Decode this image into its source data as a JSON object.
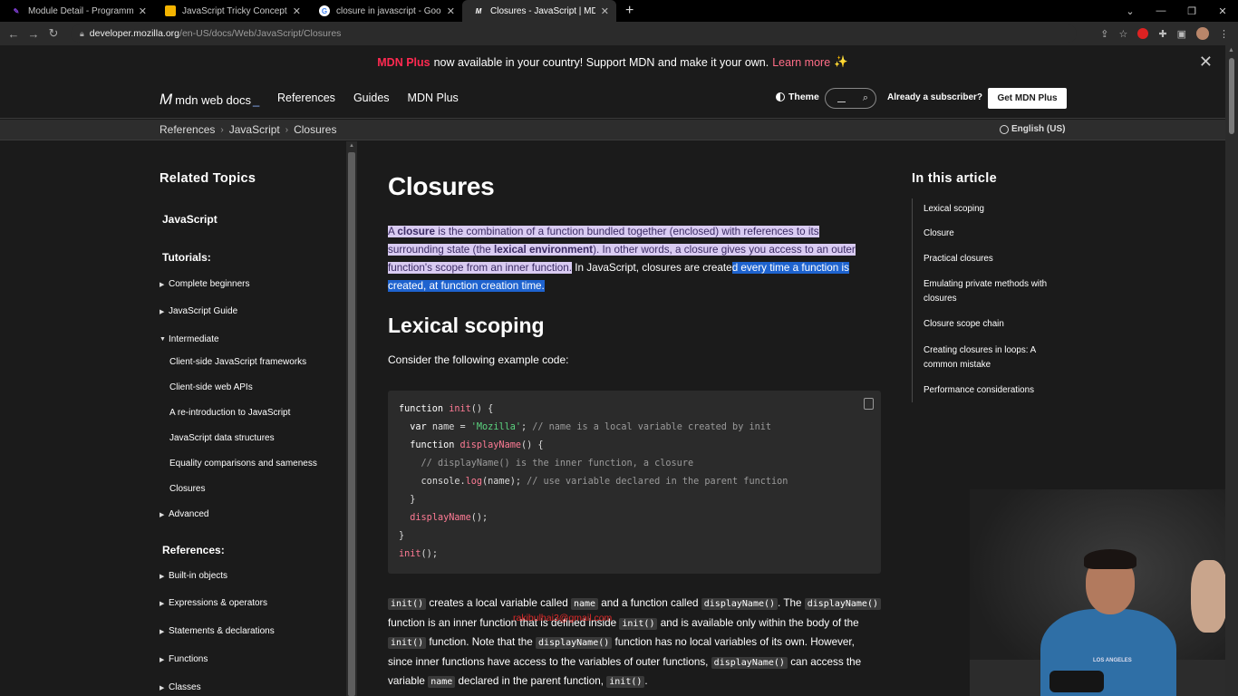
{
  "browser": {
    "tabs": [
      {
        "title": "Module Detail - Programming H",
        "favicon_color": "#7f3fd4"
      },
      {
        "title": "JavaScript Tricky Concepts - Goo",
        "favicon_color": "#f4b400"
      },
      {
        "title": "closure in javascript - Google Se",
        "favicon_color": "#ffffff"
      },
      {
        "title": "Closures - JavaScript | MDN",
        "favicon_color": "#ffffff",
        "active": true
      }
    ],
    "new_tab": "+",
    "window_controls": [
      "⌄",
      "—",
      "❐",
      "✕"
    ],
    "url_host": "developer.mozilla.org",
    "url_path": "/en-US/docs/Web/JavaScript/Closures"
  },
  "banner": {
    "brand": "MDN Plus",
    "message": "now available in your country! Support MDN and make it your own.",
    "link": "Learn more",
    "sparkle": "✨",
    "close": "✕"
  },
  "header": {
    "logo_mark": "M",
    "logo_text": "mdn web docs",
    "logo_underscore": "_",
    "nav": [
      "References",
      "Guides",
      "MDN Plus"
    ],
    "theme_label": "Theme",
    "search_icon": "⌕",
    "subscriber_text": "Already a subscriber?",
    "get_plus": "Get MDN Plus"
  },
  "breadcrumbs": [
    "References",
    "JavaScript",
    "Closures"
  ],
  "breadcrumb_sep": "›",
  "language": "English (US)",
  "sidebar": {
    "heading": "Related Topics",
    "javascript": "JavaScript",
    "tutorials_heading": "Tutorials:",
    "tutorials": [
      "Complete beginners",
      "JavaScript Guide",
      "Intermediate"
    ],
    "intermediate_items": [
      "Client-side JavaScript frameworks",
      "Client-side web APIs",
      "A re-introduction to JavaScript",
      "JavaScript data structures",
      "Equality comparisons and sameness",
      "Closures"
    ],
    "advanced": "Advanced",
    "references_heading": "References:",
    "references": [
      "Built-in objects",
      "Expressions & operators",
      "Statements & declarations",
      "Functions",
      "Classes"
    ],
    "collapsed_marker": "▶",
    "expanded_marker": "▼"
  },
  "article": {
    "title": "Closures",
    "intro": {
      "p1": "A ",
      "closure": "closure",
      "p2": " is the combination of a function bundled together (enclosed) with references to its surrounding state (the ",
      "lexenv": "lexical environment",
      "p3": "). In other words, a closure gives you access to an outer function's scope from an inner function.",
      "p4": " In JavaScript, closures are create",
      "p5": "d every time a function is created, at function creation time."
    },
    "h2": "Lexical scoping",
    "consider": "Consider the following example code:",
    "code": {
      "l1_kw": "function",
      "l1_fn": "init",
      "l1_rest": "() {",
      "l2_kw": "var",
      "l2_name": "name",
      "l2_eq": " = ",
      "l2_str": "'Mozilla'",
      "l2_semi": ";",
      "l2_cm": " // name is a local variable created by init",
      "l3_kw": "function",
      "l3_fn": "displayName",
      "l3_rest": "() {",
      "l4_cm": "// displayName() is the inner function, a closure",
      "l5_obj": "console",
      "l5_dot": ".",
      "l5_fn": "log",
      "l5_args": "(name);",
      "l5_cm": " // use variable declared in the parent function",
      "l6": "}",
      "l7_fn": "displayName",
      "l7_rest": "();",
      "l8": "}",
      "l9_fn": "init",
      "l9_rest": "();"
    },
    "para": {
      "c1": "init()",
      "t1": " creates a local variable called ",
      "c2": "name",
      "t2": " and a function called ",
      "c3": "displayName()",
      "t3": ". The ",
      "c4": "displayName()",
      "t4": " function is an inner function that is defined inside ",
      "c5": "init()",
      "t5": " and is available only within the body of the ",
      "c6": "init()",
      "t6": " function. Note that the ",
      "c7": "displayName()",
      "t7": " function has no local variables of its own. However, since inner functions have access to the variables of outer functions, ",
      "c8": "displayName()",
      "t8": " can access the variable ",
      "c9": "name",
      "t9": " declared in the parent function, ",
      "c10": "init()",
      "t10": "."
    },
    "watermark": "rakibulhai3@gmail.com"
  },
  "toc": {
    "title": "In this article",
    "items": [
      "Lexical scoping",
      "Closure",
      "Practical closures",
      "Emulating private methods with closures",
      "Closure scope chain",
      "Creating closures in loops: A common mistake",
      "Performance considerations"
    ]
  },
  "webcam_caption": "LOS ANGELES"
}
